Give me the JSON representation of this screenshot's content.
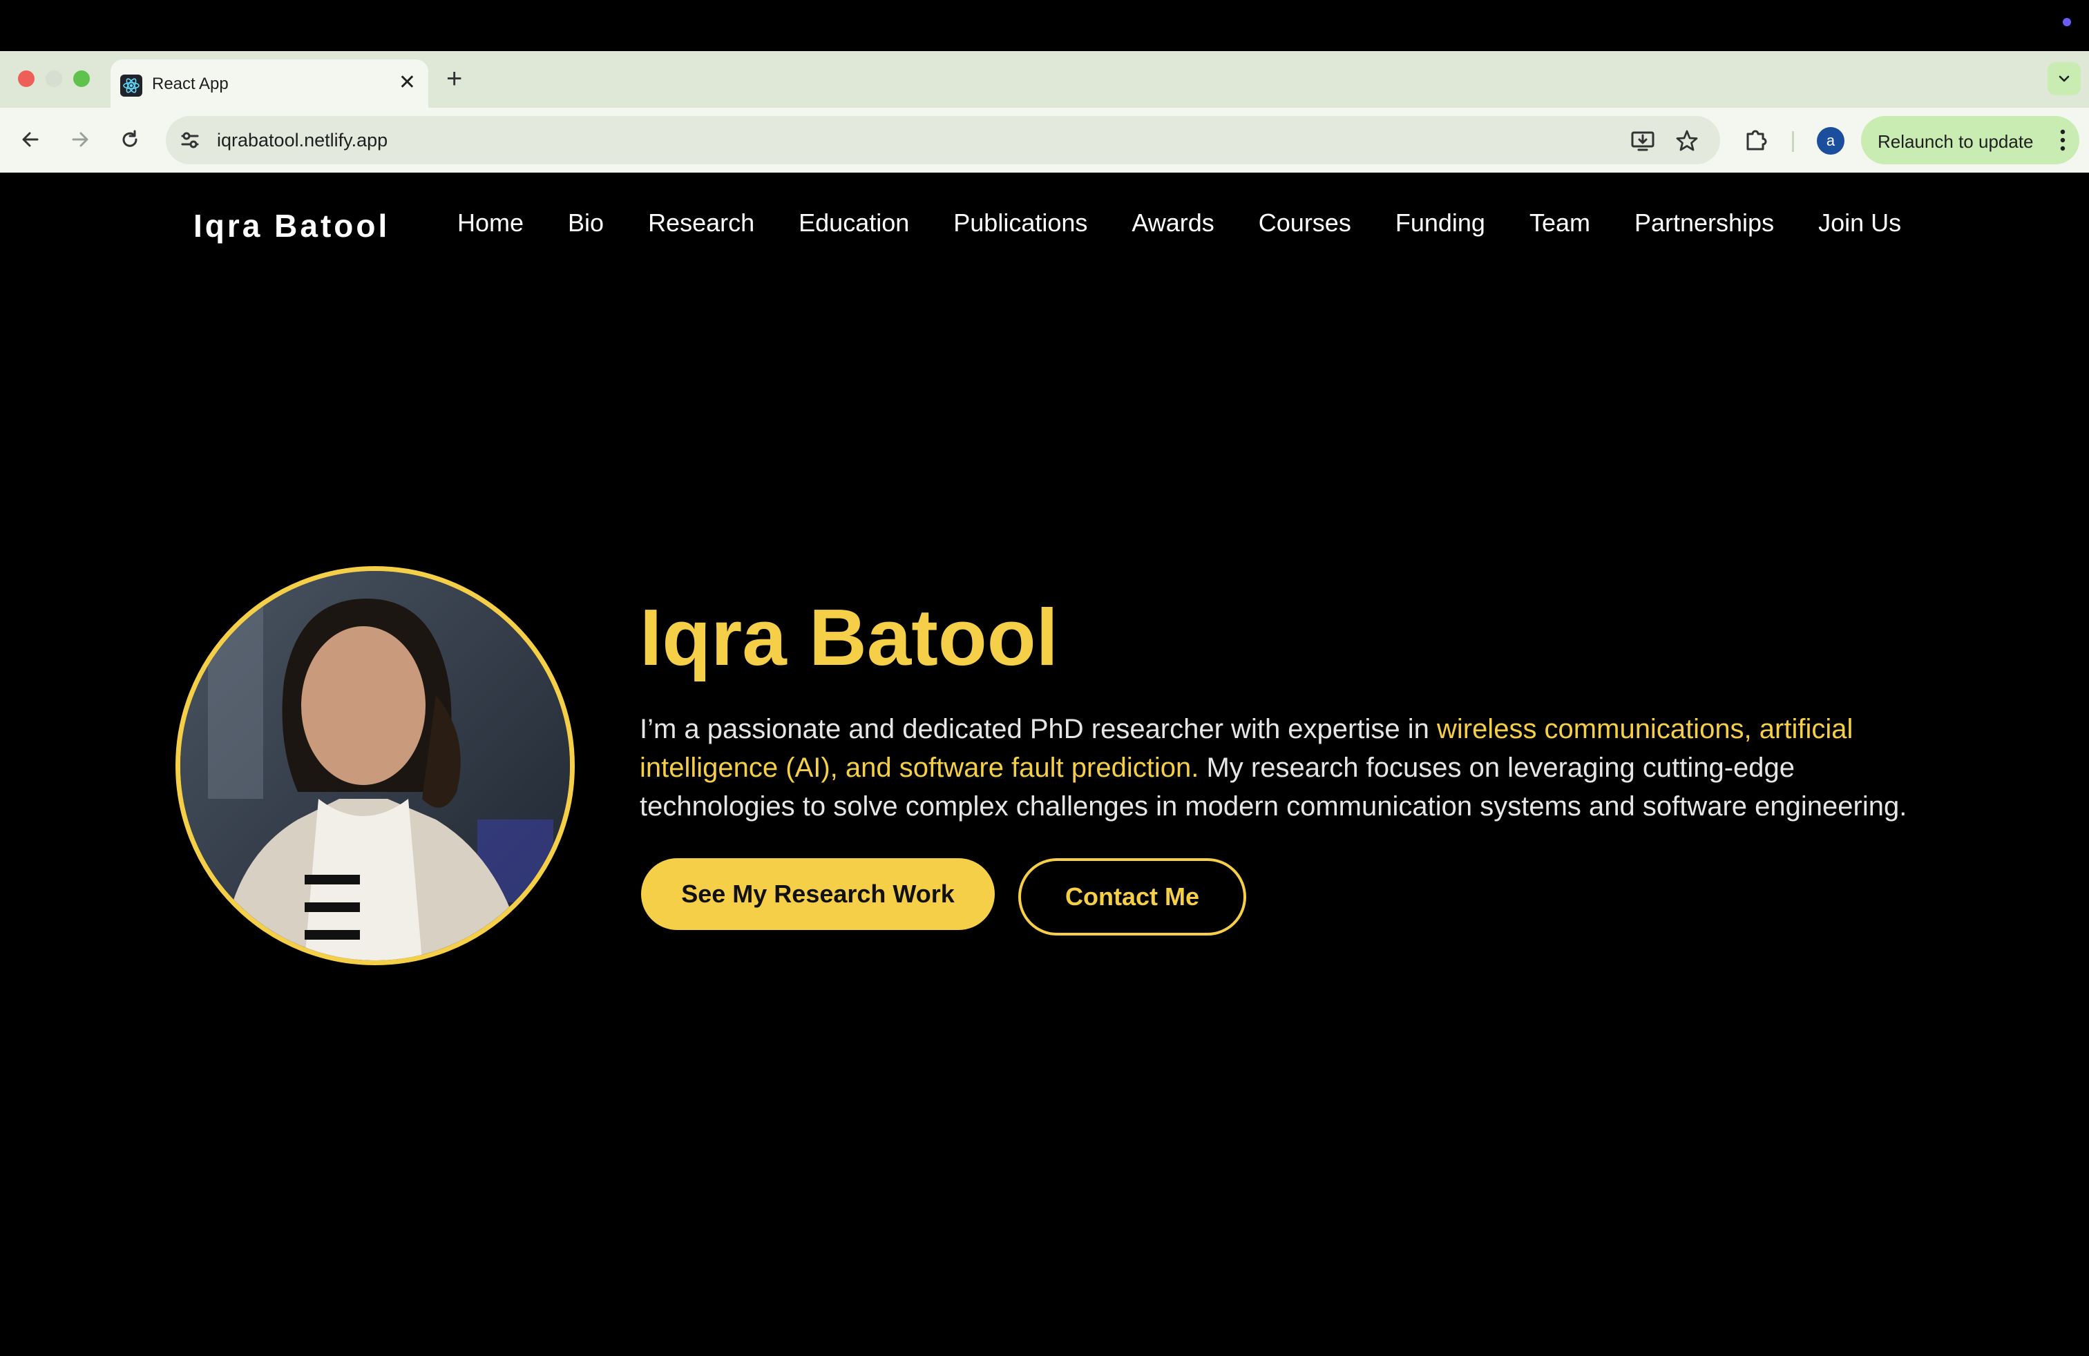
{
  "browser": {
    "tab_title": "React App",
    "url": "iqrabatool.netlify.app",
    "profile_initial": "a",
    "relaunch_label": "Relaunch to update",
    "icons": [
      "react-favicon",
      "close-icon",
      "plus-icon",
      "chevron-down-icon",
      "back-arrow-icon",
      "forward-arrow-icon",
      "reload-icon",
      "site-settings-icon",
      "install-app-icon",
      "star-icon",
      "extensions-icon",
      "kebab-menu-icon"
    ]
  },
  "site": {
    "brand": "Iqra Batool",
    "nav": [
      {
        "label": "Home"
      },
      {
        "label": "Bio"
      },
      {
        "label": "Research"
      },
      {
        "label": "Education"
      },
      {
        "label": "Publications"
      },
      {
        "label": "Awards"
      },
      {
        "label": "Courses"
      },
      {
        "label": "Funding"
      },
      {
        "label": "Team"
      },
      {
        "label": "Partnerships"
      },
      {
        "label": "Join Us"
      }
    ],
    "hero": {
      "name": "Iqra Batool",
      "bio_part1": "I’m a passionate and dedicated PhD researcher with expertise in ",
      "bio_highlight": "wireless communications, artificial intelligence (AI), and software fault prediction.",
      "bio_part2": " My research focuses on leveraging cutting-edge technologies to solve complex challenges in modern communication systems and software engineering.",
      "primary_button": "See My Research Work",
      "secondary_button": "Contact Me"
    }
  },
  "colors": {
    "accent": "#f5cf47",
    "background": "#000000",
    "text": "#ffffff"
  }
}
